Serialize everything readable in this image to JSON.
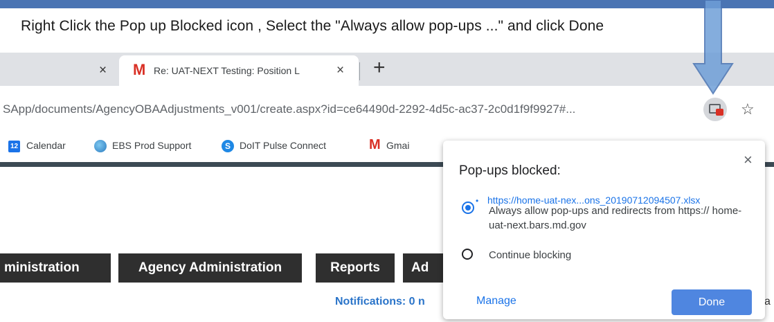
{
  "instruction": "Right Click the Pop up Blocked icon , Select the \"Always allow pop-ups ...\" and click Done",
  "tabs": [
    {
      "close_label": "×"
    },
    {
      "title": "Re: UAT-NEXT Testing: Position L",
      "close_label": "×"
    }
  ],
  "new_tab_label": "+",
  "address_bar": {
    "url": "SApp/documents/AgencyOBAAdjustments_v001/create.aspx?id=ce64490d-2292-4d5c-ac37-2c0d1f9f9927#..."
  },
  "bookmarks": [
    {
      "icon": "calendar-icon",
      "label": "Calendar",
      "icon_text": "12"
    },
    {
      "icon": "globe-icon",
      "label": "EBS Prod Support"
    },
    {
      "icon": "pulse-icon",
      "label": "DoIT Pulse Connect",
      "icon_text": "S"
    },
    {
      "icon": "gmail-icon",
      "label": "Gmai"
    }
  ],
  "nav": {
    "items": [
      "ministration",
      "Agency Administration",
      "Reports",
      "Ad"
    ]
  },
  "notifications": "Notifications: 0 n",
  "right_edge_text": "a",
  "popup": {
    "title": "Pop-ups blocked:",
    "close_label": "×",
    "link": "https://home-uat-nex...ons_20190712094507.xlsx",
    "options": [
      {
        "label": "Always allow pop-ups and redirects from https:// home-uat-next.bars.md.gov",
        "selected": true
      },
      {
        "label": "Continue blocking",
        "selected": false
      }
    ],
    "manage_label": "Manage",
    "done_label": "Done"
  },
  "colors": {
    "accent": "#1a73e8",
    "gmail_red": "#d93025",
    "nav_dark": "#2f2f2f",
    "guide_arrow": "#6f9fd8"
  }
}
